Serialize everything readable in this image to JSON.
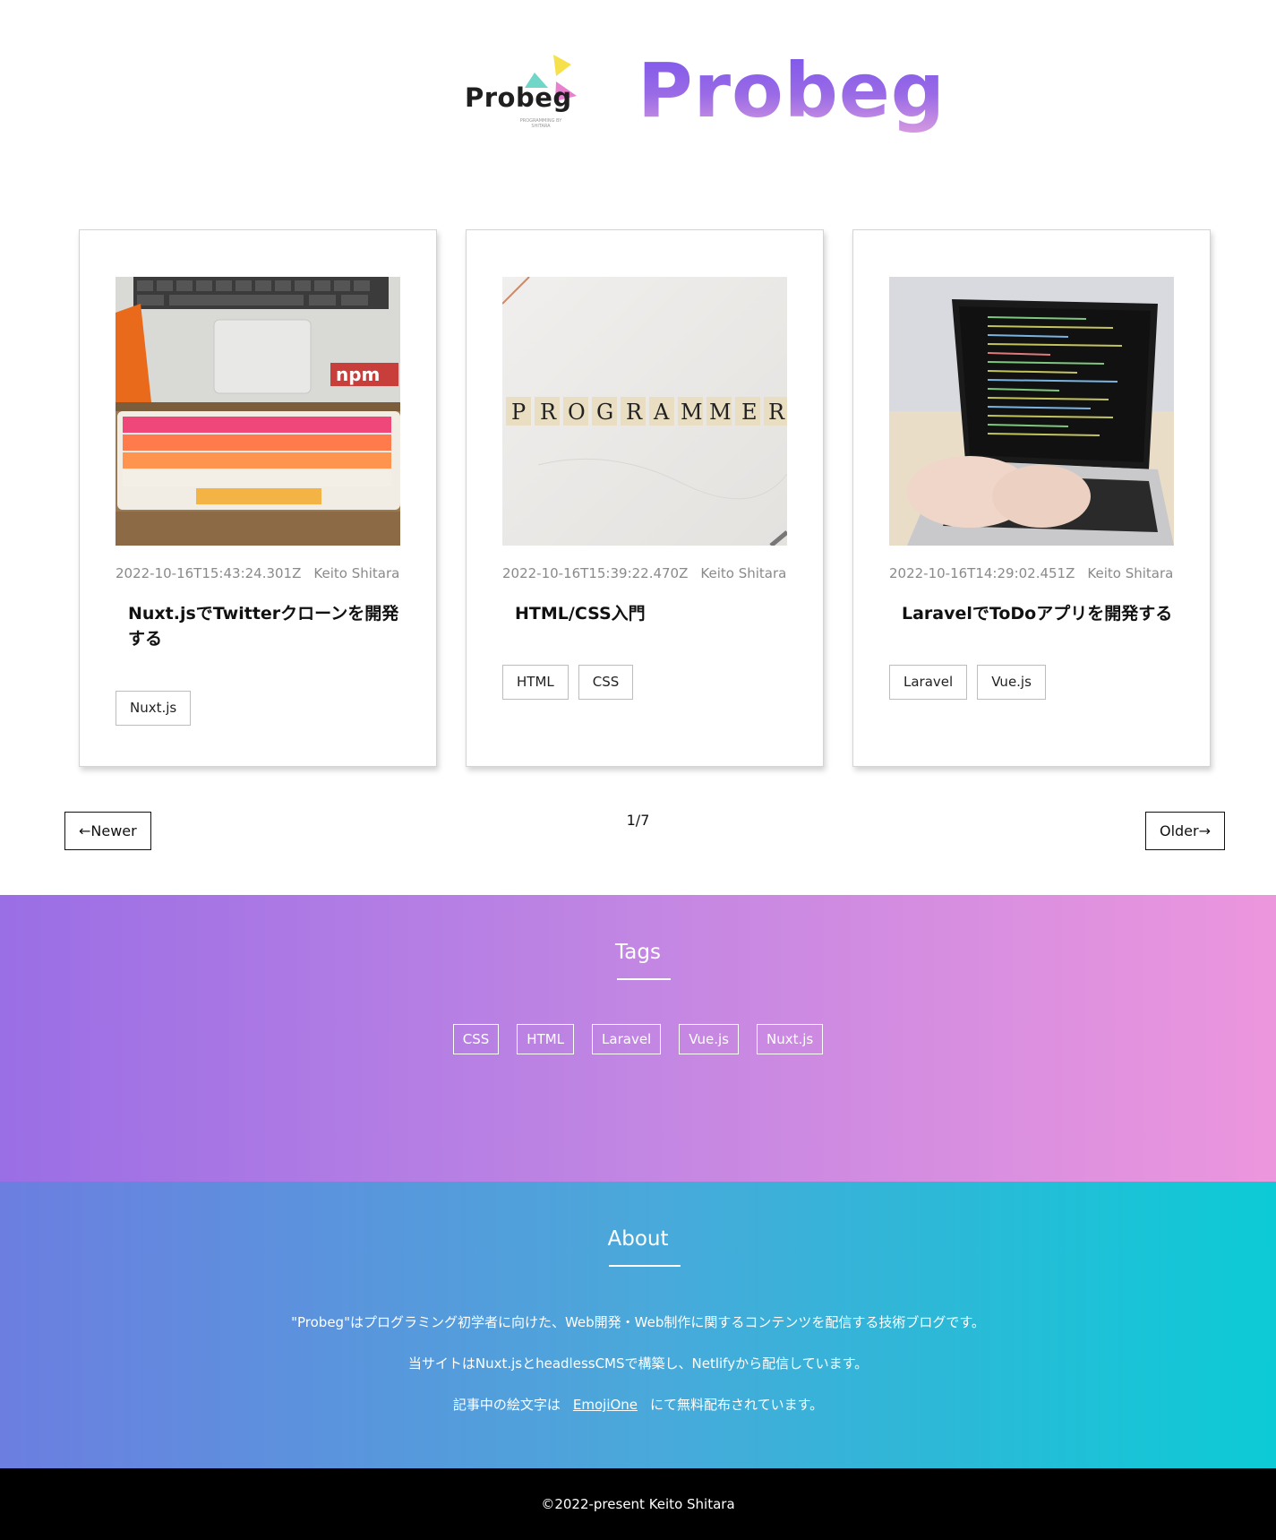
{
  "header": {
    "logo_word": "Probeg",
    "logo_sub": "PROGRAMMING BY SHITARA",
    "brand": "Probeg"
  },
  "cards": [
    {
      "date": "2022-10-16T15:43:24.301Z",
      "author": "Keito Shitara",
      "title": "Nuxt.jsでTwitterクローンを開発する",
      "image": "keyboard-and-laptop-with-npm-sticker",
      "tags": [
        "Nuxt.js"
      ]
    },
    {
      "date": "2022-10-16T15:39:22.470Z",
      "author": "Keito Shitara",
      "title": "HTML/CSS入門",
      "image": "programmer-letter-tiles",
      "tile_text": "PROGRAMMER",
      "tags": [
        "HTML",
        "CSS"
      ]
    },
    {
      "date": "2022-10-16T14:29:02.451Z",
      "author": "Keito Shitara",
      "title": "LaravelでToDoアプリを開発する",
      "image": "hands-typing-on-laptop-with-code",
      "tags": [
        "Laravel",
        "Vue.js"
      ]
    }
  ],
  "pagination": {
    "newer": "←Newer",
    "page": "1/7",
    "older": "Older→"
  },
  "tags_section": {
    "title": "Tags",
    "tags": [
      "CSS",
      "HTML",
      "Laravel",
      "Vue.js",
      "Nuxt.js"
    ]
  },
  "about": {
    "title": "About",
    "line1": "\"Probeg\"はプログラミング初学者に向けた、Web開発・Web制作に関するコンテンツを配信する技術ブログです。",
    "line2": "当サイトはNuxt.jsとheadlessCMSで構築し、Netlifyから配信しています。",
    "line3_before": "記事中の絵文字は",
    "line3_link": "EmojiOne",
    "line3_after": "にて無料配布されています。"
  },
  "footer": {
    "copyright": "©2022-present Keito Shitara"
  },
  "colors": {
    "brand_purple": "#7a54ec",
    "tags_gradient_start": "#9a6ee5",
    "tags_gradient_end": "#ec96dd",
    "about_gradient_start": "#6c7ee0",
    "about_gradient_end": "#0ccbd6"
  }
}
